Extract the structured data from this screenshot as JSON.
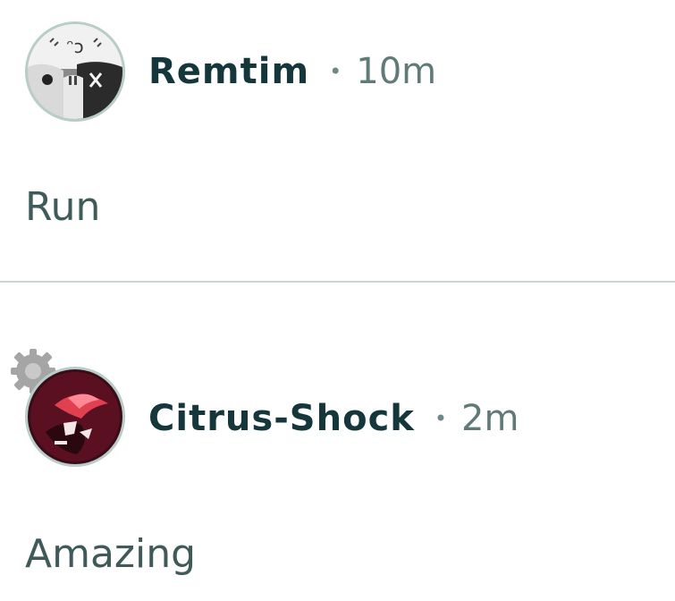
{
  "comments": [
    {
      "username": "Remtim",
      "separator": "•",
      "time": "10m",
      "text": "Run",
      "avatar_icon": "remtim-avatar-icon"
    },
    {
      "username": "Citrus-Shock",
      "separator": "•",
      "time": "2m",
      "text": "Amazing",
      "avatar_icon": "citrus-shock-avatar-icon",
      "badge_icon": "gear-badge-icon"
    }
  ],
  "colors": {
    "username": "#15363a",
    "timestamp": "#5f7a77",
    "body_text": "#3f5a58",
    "divider": "#c9d6d2",
    "avatar_ring": "#b8cdc7"
  }
}
